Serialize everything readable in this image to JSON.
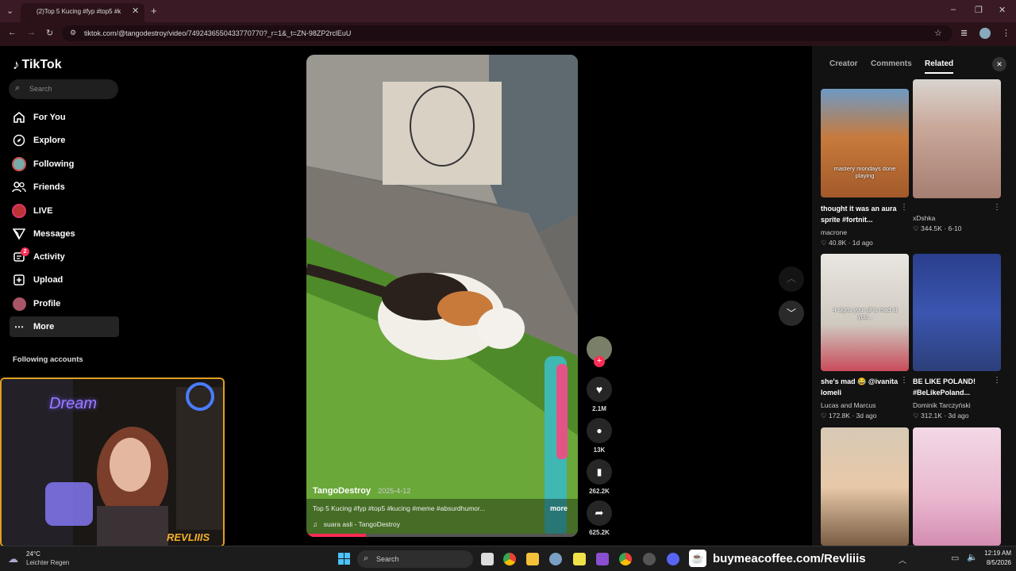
{
  "browser": {
    "tab_title": "(2)Top 5 Kucing #fyp #top5 #k",
    "url": "tiktok.com/@tangodestroy/video/7492436550433770770?_r=1&_t=ZN-98ZP2rclEuU"
  },
  "sidebar": {
    "logo": "TikTok",
    "search_placeholder": "Search",
    "items": [
      {
        "label": "For You",
        "icon": "home-icon"
      },
      {
        "label": "Explore",
        "icon": "compass-icon"
      },
      {
        "label": "Following",
        "icon": "avatar-icon"
      },
      {
        "label": "Friends",
        "icon": "friends-icon"
      },
      {
        "label": "LIVE",
        "icon": "live-avatar-icon"
      },
      {
        "label": "Messages",
        "icon": "send-icon"
      },
      {
        "label": "Activity",
        "icon": "activity-icon",
        "badge": "2"
      },
      {
        "label": "Upload",
        "icon": "plus-square-icon"
      },
      {
        "label": "Profile",
        "icon": "profile-avatar-icon"
      },
      {
        "label": "More",
        "icon": "ellipsis-icon"
      }
    ],
    "following_header": "Following accounts"
  },
  "video": {
    "author": "TangoDestroy",
    "date": "2025-4-12",
    "caption": "Top 5 Kucing #fyp #top5 #kucing #meme #absurdhumor...",
    "more": "more",
    "sound": "suara asli - TangoDestroy",
    "likes": "2.1M",
    "comments": "13K",
    "saves": "262.2K",
    "shares": "625.2K"
  },
  "panel": {
    "tabs": [
      "Creator",
      "Comments",
      "Related"
    ],
    "active_tab": "Related",
    "related": [
      {
        "title": "thought it was an aura sprite #fortnit...",
        "author": "macrone",
        "likes": "40.8K",
        "age": "1d ago",
        "overlay": "mastery mondays done playing"
      },
      {
        "title": "",
        "author": "xDshka",
        "likes": "344.5K",
        "age": "6-10",
        "overlay": ""
      },
      {
        "title": "she's mad 😂 @ivanita lomeli",
        "author": "Lucas and Marcus",
        "likes": "172.8K",
        "age": "3d ago",
        "overlay": "4 signs your gf is mad at you..."
      },
      {
        "title": "BE LIKE POLAND! #BeLikePoland...",
        "author": "Dominik Tarczyński",
        "likes": "312.1K",
        "age": "3d ago",
        "overlay": ""
      }
    ]
  },
  "taskbar": {
    "weather_temp": "24°C",
    "weather_desc": "Leichter Regen",
    "search": "Search",
    "banner": "buymeacoffee.com/Revliiis",
    "time": "12:19 AM",
    "date": "8/5/2026"
  },
  "webcam": {
    "sign": "Dream",
    "brand": "REVLIIIS"
  }
}
